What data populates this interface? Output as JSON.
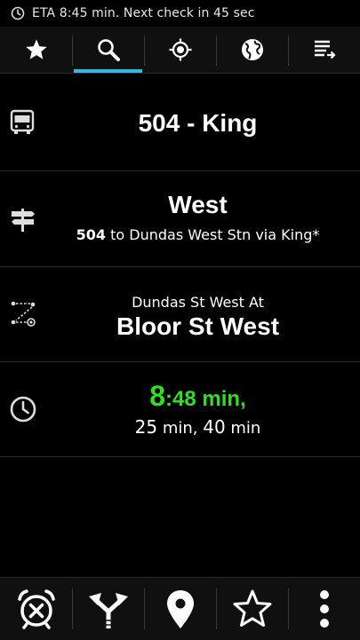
{
  "status_bar": {
    "icon": "clock-icon",
    "text": "ETA 8:45 min. Next check in 45 sec"
  },
  "tabs": [
    {
      "icon": "star-icon",
      "active": false
    },
    {
      "icon": "search-icon",
      "active": true
    },
    {
      "icon": "location-target-icon",
      "active": false
    },
    {
      "icon": "globe-icon",
      "active": false
    },
    {
      "icon": "list-arrow-icon",
      "active": false
    }
  ],
  "route": {
    "icon": "bus-icon",
    "title": "504 - King"
  },
  "direction": {
    "icon": "signpost-icon",
    "title": "West",
    "route_number": "504",
    "subtitle": " to Dundas West Stn via King*"
  },
  "stop": {
    "icon": "route-path-icon",
    "street": "Dundas St West At",
    "cross_street": "Bloor St West"
  },
  "eta": {
    "icon": "clock-icon",
    "first_minutes": "8",
    "first_rest": ":48 min,",
    "next_1": "25",
    "next_1_unit": " min, ",
    "next_2": "40",
    "next_2_unit": " min"
  },
  "bottom_bar": [
    {
      "icon": "alarm-cancel-icon"
    },
    {
      "icon": "fork-arrows-icon"
    },
    {
      "icon": "map-pin-icon"
    },
    {
      "icon": "star-outline-icon"
    },
    {
      "icon": "overflow-menu-icon"
    }
  ],
  "colors": {
    "accent": "#33b5e5",
    "eta_green": "#33dd22",
    "background": "#000000"
  }
}
